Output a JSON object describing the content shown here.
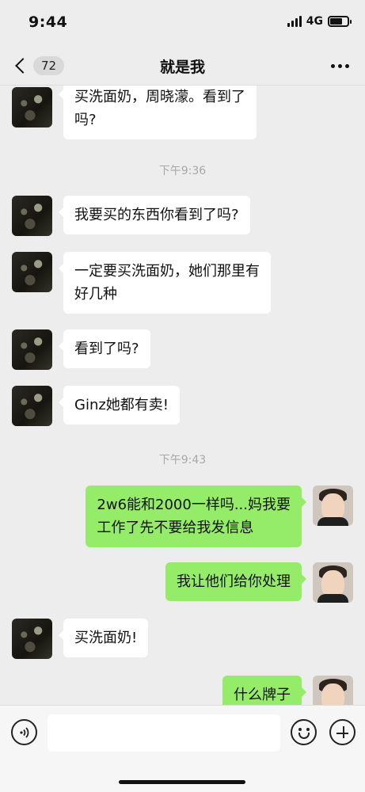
{
  "status_bar": {
    "time": "9:44",
    "network": "4G"
  },
  "nav": {
    "unread_count": "72",
    "title": "就是我"
  },
  "messages": [
    {
      "side": "in",
      "text": "买洗面奶，周晓濛。看到了\n吗?"
    },
    {
      "type": "time",
      "text": "下午9:36"
    },
    {
      "side": "in",
      "text": "我要买的东西你看到了吗?"
    },
    {
      "side": "in",
      "text": "一定要买洗面奶，她们那里有\n好几种"
    },
    {
      "side": "in",
      "text": "看到了吗?"
    },
    {
      "side": "in",
      "text": "Ginz她都有卖!"
    },
    {
      "type": "time",
      "text": "下午9:43"
    },
    {
      "side": "out",
      "text": "2w6能和2000一样吗...妈我要\n工作了先不要给我发信息"
    },
    {
      "side": "out",
      "text": "我让他们给你处理"
    },
    {
      "side": "in",
      "text": "买洗面奶!"
    },
    {
      "side": "out",
      "text": "什么牌子"
    }
  ],
  "icons": {
    "back": "chevron-left-icon",
    "more": "more-dots-icon",
    "voice": "voice-icon",
    "emoji": "emoji-icon",
    "plus": "plus-icon"
  },
  "colors": {
    "background": "#ededed",
    "incoming_bubble": "#ffffff",
    "outgoing_bubble": "#95ec69",
    "timestamp": "#a8a8a8"
  }
}
